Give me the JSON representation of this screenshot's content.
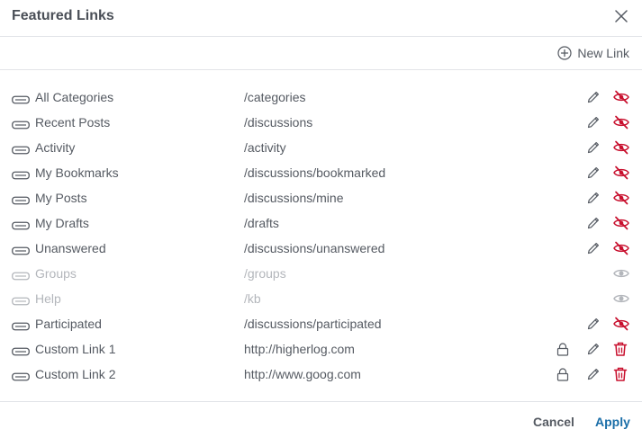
{
  "dialog": {
    "title": "Featured Links",
    "close_icon": "close-icon"
  },
  "toolbar": {
    "new_link_label": "New Link",
    "new_link_icon": "plus-circle-icon"
  },
  "links": [
    {
      "name": "All Categories",
      "url": "/categories",
      "visible": true,
      "custom": false
    },
    {
      "name": "Recent Posts",
      "url": "/discussions",
      "visible": true,
      "custom": false
    },
    {
      "name": "Activity",
      "url": "/activity",
      "visible": true,
      "custom": false
    },
    {
      "name": "My Bookmarks",
      "url": "/discussions/bookmarked",
      "visible": true,
      "custom": false
    },
    {
      "name": "My Posts",
      "url": "/discussions/mine",
      "visible": true,
      "custom": false
    },
    {
      "name": "My Drafts",
      "url": "/drafts",
      "visible": true,
      "custom": false
    },
    {
      "name": "Unanswered",
      "url": "/discussions/unanswered",
      "visible": true,
      "custom": false
    },
    {
      "name": "Groups",
      "url": "/groups",
      "visible": false,
      "custom": false
    },
    {
      "name": "Help",
      "url": "/kb",
      "visible": false,
      "custom": false
    },
    {
      "name": "Participated",
      "url": "/discussions/participated",
      "visible": true,
      "custom": false
    },
    {
      "name": "Custom Link 1",
      "url": "http://higherlog.com",
      "visible": true,
      "custom": true
    },
    {
      "name": "Custom Link 2",
      "url": "http://www.goog.com",
      "visible": true,
      "custom": true
    }
  ],
  "footer": {
    "cancel_label": "Cancel",
    "apply_label": "Apply"
  },
  "colors": {
    "text": "#555a62",
    "disabled_text": "#b3b6bb",
    "danger": "#c8102e",
    "accent": "#1a6ea8",
    "divider": "#e2e4e8"
  }
}
